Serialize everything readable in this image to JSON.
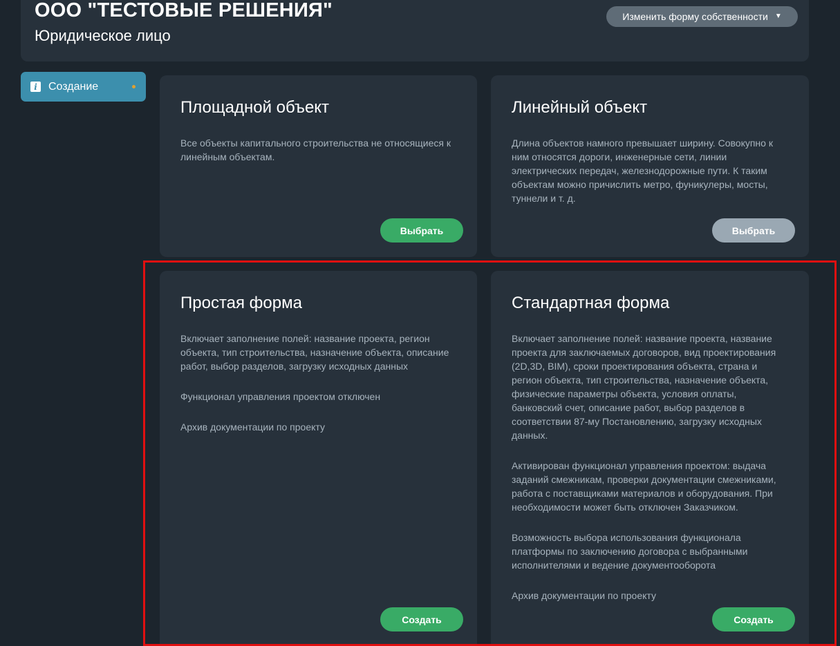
{
  "header": {
    "company_name": "ООО \"ТЕСТОВЫЕ РЕШЕНИЯ\"",
    "entity_type": "Юридическое лицо",
    "change_button": "Изменить форму собственности",
    "change_icon": "caret-down-icon"
  },
  "sidebar": {
    "items": [
      {
        "label": "Создание",
        "icon": "info-icon",
        "status_dot_color": "#e0a030"
      }
    ]
  },
  "cards": [
    {
      "title": "Площадной объект",
      "paragraphs": [
        "Все объекты капитального строительства не относящиеся к линейным объектам."
      ],
      "button": "Выбрать"
    },
    {
      "title": "Линейный объект",
      "paragraphs": [
        "Длина объектов намного превышает ширину. Совокупно к ним относятся дороги, инженерные сети, линии электрических передач, железнодорожные пути. К таким объектам можно причислить метро, фуникулеры, мосты, туннели и т. д."
      ],
      "button": "Выбрать"
    },
    {
      "title": "Простая форма",
      "paragraphs": [
        "Включает заполнение полей: название проекта, регион объекта, тип строительства, назначение объекта, описание работ, выбор разделов, загрузку исходных данных",
        "Функционал управления проектом отключен",
        "Архив документации по проекту"
      ],
      "button": "Создать"
    },
    {
      "title": "Стандартная форма",
      "paragraphs": [
        "Включает заполнение полей: название проекта, название проекта для заключаемых договоров, вид проектирования (2D,3D, BIM), сроки проектирования объекта, страна и регион объекта, тип строительства, назначение объекта, физические параметры объекта, условия оплаты, банковский счет, описание работ, выбор разделов в соответствии 87-му Постановлению, загрузку исходных данных.",
        "Активирован функционал управления проектом: выдача заданий смежникам, проверки документации смежниками, работа с поставщиками материалов и оборудования. При необходимости может быть отключен Заказчиком.",
        "Возможность выбора использования функционала платформы по заключению договора с выбранными исполнителями и ведение документооборота",
        "Архив документации по проекту"
      ],
      "button": "Создать"
    }
  ],
  "colors": {
    "background": "#1c252d",
    "panel": "#27313b",
    "accent_blue": "#3c8fad",
    "button_green": "#39ab66",
    "button_gray": "#9aa8b3",
    "highlight_red": "#e01010"
  }
}
